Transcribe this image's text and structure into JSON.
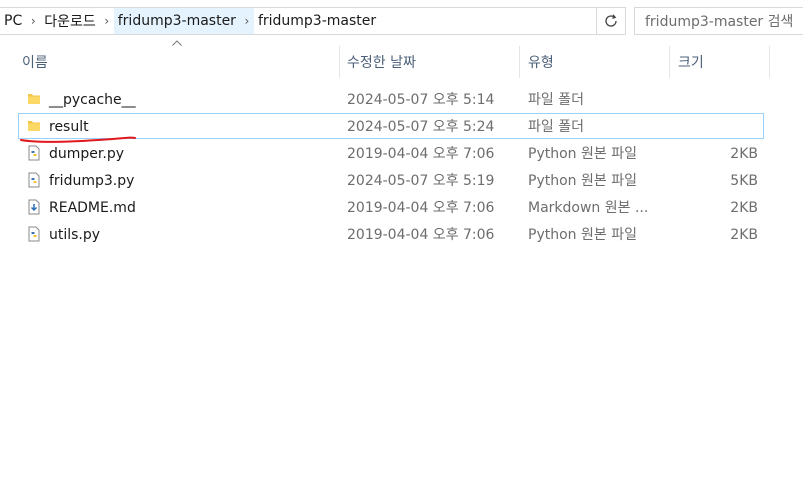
{
  "address_bar": {
    "crumbs": [
      "PC",
      "다운로드",
      "fridump3-master",
      "fridump3-master"
    ]
  },
  "search": {
    "placeholder": "fridump3-master 검색"
  },
  "columns": {
    "name": "이름",
    "date": "수정한 날짜",
    "type": "유형",
    "size": "크기"
  },
  "files": [
    {
      "name": "__pycache__",
      "date": "2024-05-07 오후 5:14",
      "type": "파일 폴더",
      "size": "",
      "icon": "folder-icon"
    },
    {
      "name": "result",
      "date": "2024-05-07 오후 5:24",
      "type": "파일 폴더",
      "size": "",
      "icon": "folder-icon"
    },
    {
      "name": "dumper.py",
      "date": "2019-04-04 오후 7:06",
      "type": "Python 원본 파일",
      "size": "2KB",
      "icon": "python-file-icon"
    },
    {
      "name": "fridump3.py",
      "date": "2024-05-07 오후 5:19",
      "type": "Python 원본 파일",
      "size": "5KB",
      "icon": "python-file-icon"
    },
    {
      "name": "README.md",
      "date": "2019-04-04 오후 7:06",
      "type": "Markdown 원본 ...",
      "size": "2KB",
      "icon": "markdown-file-icon"
    },
    {
      "name": "utils.py",
      "date": "2019-04-04 오후 7:06",
      "type": "Python 원본 파일",
      "size": "2KB",
      "icon": "python-file-icon"
    }
  ],
  "selected_index": 1,
  "colors": {
    "accent": "#99d1ff",
    "annotation": "#e0191e",
    "folder": "#f4c64b"
  },
  "icons": {
    "refresh": "refresh-icon",
    "dropdown": "chevron-down-icon",
    "sort": "sort-up-icon"
  }
}
